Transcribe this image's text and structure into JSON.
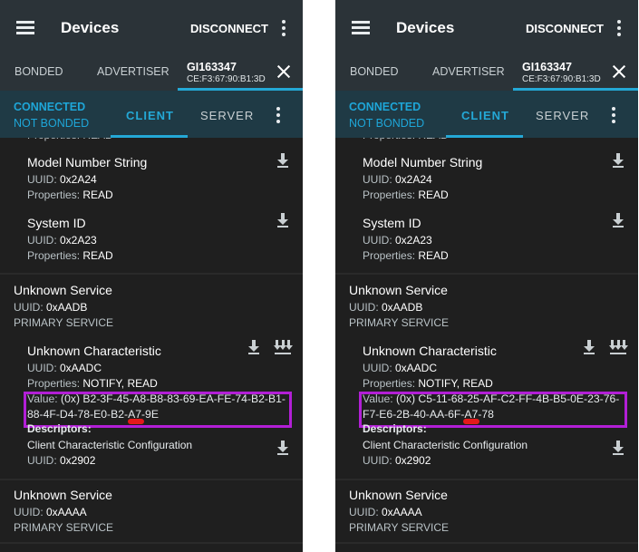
{
  "appbar": {
    "title": "Devices",
    "disconnect_label": "DISCONNECT"
  },
  "top_tabs": {
    "bonded": "BONDED",
    "advertiser": "ADVERTISER"
  },
  "status": {
    "connected": "CONNECTED",
    "bonded": "NOT BONDED"
  },
  "sub_tabs": {
    "client": "CLIENT",
    "server": "SERVER"
  },
  "icons": [
    "menu-icon",
    "overflow-menu-icon",
    "close-icon",
    "download-icon",
    "notify-icon"
  ],
  "colors": {
    "accent": "#24a8d6",
    "highlight": "#b21fd6",
    "marker": "#e31a1a"
  },
  "phones": [
    {
      "device": {
        "name": "GI163347",
        "mac": "CE:F3:67:90:B1:3D"
      },
      "cut_text": "Properties: READ",
      "chars": [
        {
          "name": "Model Number String",
          "uuid_label": "UUID: ",
          "uuid": "0x2A24",
          "props_label": "Properties: ",
          "props": "READ"
        },
        {
          "name": "System ID",
          "uuid_label": "UUID: ",
          "uuid": "0x2A23",
          "props_label": "Properties: ",
          "props": "READ"
        }
      ],
      "service1": {
        "name": "Unknown Service",
        "uuid_label": "UUID: ",
        "uuid": "0xAADB",
        "type": "PRIMARY SERVICE"
      },
      "characteristic": {
        "name": "Unknown Characteristic",
        "uuid_label": "UUID: ",
        "uuid": "0xAADC",
        "props_label": "Properties: ",
        "props": "NOTIFY, READ",
        "value_label": "Value: ",
        "value_line1": "(0x) B2-3F-45-A8-B8-83-69-EA-FE-74-B2-B1-",
        "value_line2": "88-4F-D4-78-E0-B2-A7-9E",
        "descriptors_label": "Descriptors:",
        "descriptor_name": "Client Characteristic Configuration",
        "descriptor_uuid_label": "UUID: ",
        "descriptor_uuid": "0x2902"
      },
      "service2": {
        "name": "Unknown Service",
        "uuid_label": "UUID: ",
        "uuid": "0xAAAA",
        "type": "PRIMARY SERVICE"
      }
    },
    {
      "device": {
        "name": "GI163347",
        "mac": "CE:F3:67:90:B1:3D"
      },
      "cut_text": "Properties: READ",
      "chars": [
        {
          "name": "Model Number String",
          "uuid_label": "UUID: ",
          "uuid": "0x2A24",
          "props_label": "Properties: ",
          "props": "READ"
        },
        {
          "name": "System ID",
          "uuid_label": "UUID: ",
          "uuid": "0x2A23",
          "props_label": "Properties: ",
          "props": "READ"
        }
      ],
      "service1": {
        "name": "Unknown Service",
        "uuid_label": "UUID: ",
        "uuid": "0xAADB",
        "type": "PRIMARY SERVICE"
      },
      "characteristic": {
        "name": "Unknown Characteristic",
        "uuid_label": "UUID: ",
        "uuid": "0xAADC",
        "props_label": "Properties: ",
        "props": "NOTIFY, READ",
        "value_label": "Value: ",
        "value_line1": "(0x) C5-11-68-25-AF-C2-FF-4B-B5-0E-23-76-",
        "value_line2": "F7-E6-2B-40-AA-6F-A7-78",
        "descriptors_label": "Descriptors:",
        "descriptor_name": "Client Characteristic Configuration",
        "descriptor_uuid_label": "UUID: ",
        "descriptor_uuid": "0x2902"
      },
      "service2": {
        "name": "Unknown Service",
        "uuid_label": "UUID: ",
        "uuid": "0xAAAA",
        "type": "PRIMARY SERVICE"
      }
    }
  ]
}
